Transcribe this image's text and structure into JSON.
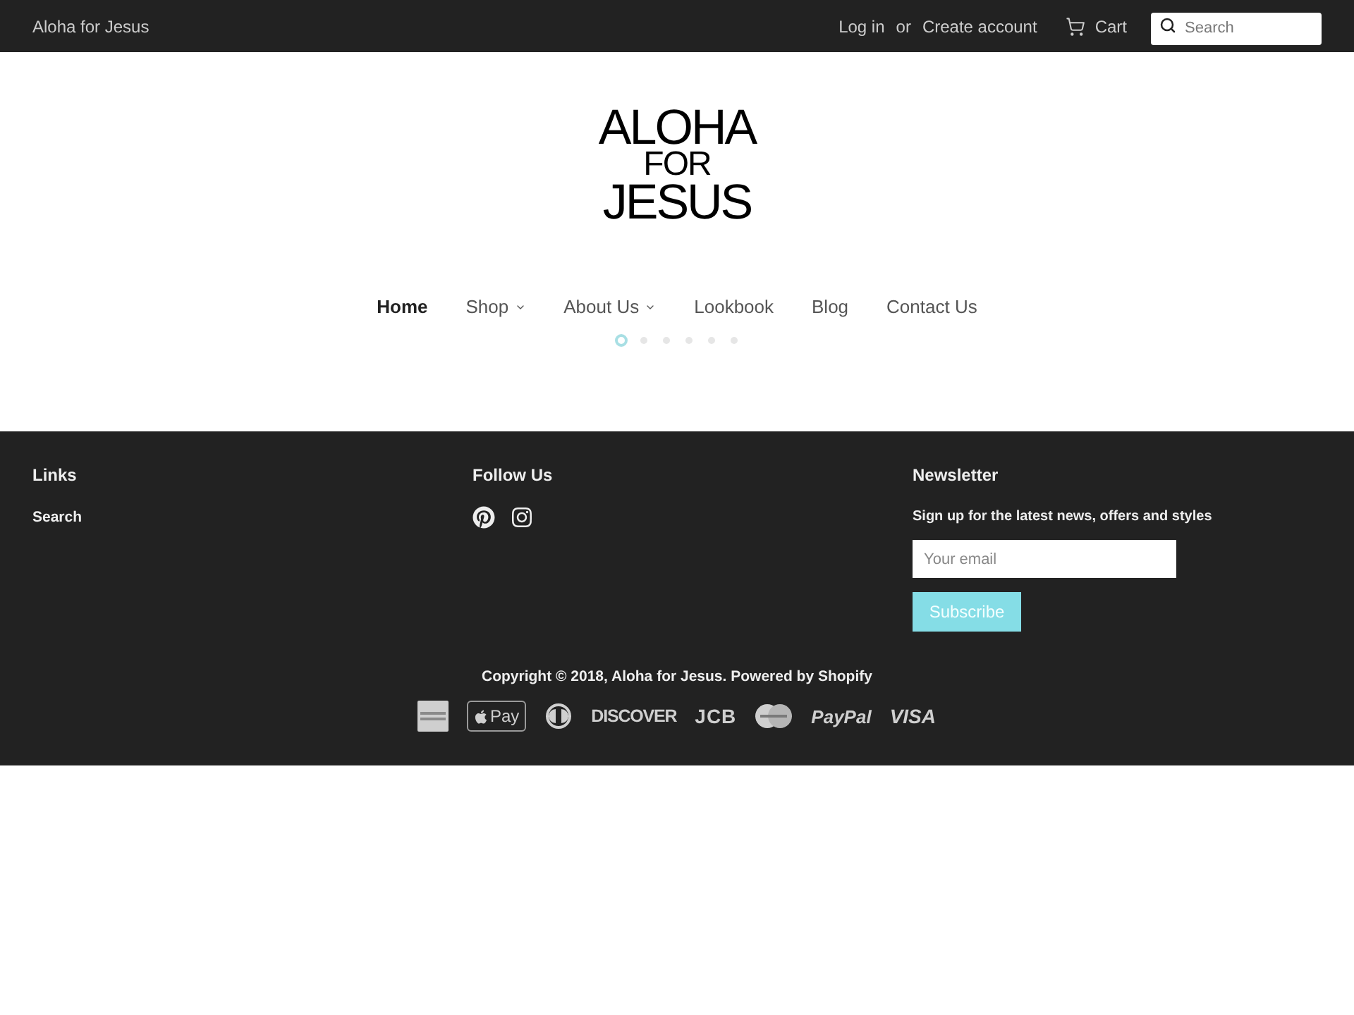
{
  "top_bar": {
    "store_name": "Aloha for Jesus",
    "login_link": "Log in",
    "separator": "or",
    "register_link": "Create account",
    "cart_link": "Cart",
    "search": {
      "placeholder": "Search"
    }
  },
  "logo": {
    "lines": [
      "ALOHA",
      "FOR",
      "JESUS"
    ]
  },
  "nav": [
    {
      "label": "Home",
      "selected": true,
      "has_dropdown": false
    },
    {
      "label": "Shop",
      "selected": false,
      "has_dropdown": true
    },
    {
      "label": "About Us",
      "selected": false,
      "has_dropdown": true
    },
    {
      "label": "Lookbook",
      "selected": false,
      "has_dropdown": false
    },
    {
      "label": "Blog",
      "selected": false,
      "has_dropdown": false
    },
    {
      "label": "Contact Us",
      "selected": false,
      "has_dropdown": false
    }
  ],
  "carousel_dots": [
    {
      "selected": true
    },
    {
      "selected": false
    },
    {
      "selected": false
    },
    {
      "selected": false
    },
    {
      "selected": false
    },
    {
      "selected": false
    }
  ],
  "footer": {
    "links_column": {
      "heading": "Links",
      "items": [
        "Search"
      ]
    },
    "follow_column": {
      "heading": "Follow Us",
      "social": [
        {
          "kind": "pinterest"
        },
        {
          "kind": "instagram"
        }
      ]
    },
    "newsletter": {
      "heading": "Newsletter",
      "text": "Sign up for the latest news, offers and styles",
      "email": {
        "placeholder": "Your email"
      },
      "button": "Subscribe"
    },
    "copyright": {
      "prefix": "Copyright © 2018,",
      "store_link": "Aloha for Jesus",
      "suffix": ".",
      "powered_link": "Powered by Shopify"
    },
    "payment_methods": [
      {
        "kind": "amex"
      },
      {
        "kind": "apple_pay",
        "label": "Pay"
      },
      {
        "kind": "diners"
      },
      {
        "kind": "discover",
        "label": "DISCOVER"
      },
      {
        "kind": "jcb",
        "label": "JCB"
      },
      {
        "kind": "mastercard"
      },
      {
        "kind": "paypal",
        "label": "PayPal"
      },
      {
        "kind": "visa",
        "label": "VISA"
      }
    ]
  }
}
